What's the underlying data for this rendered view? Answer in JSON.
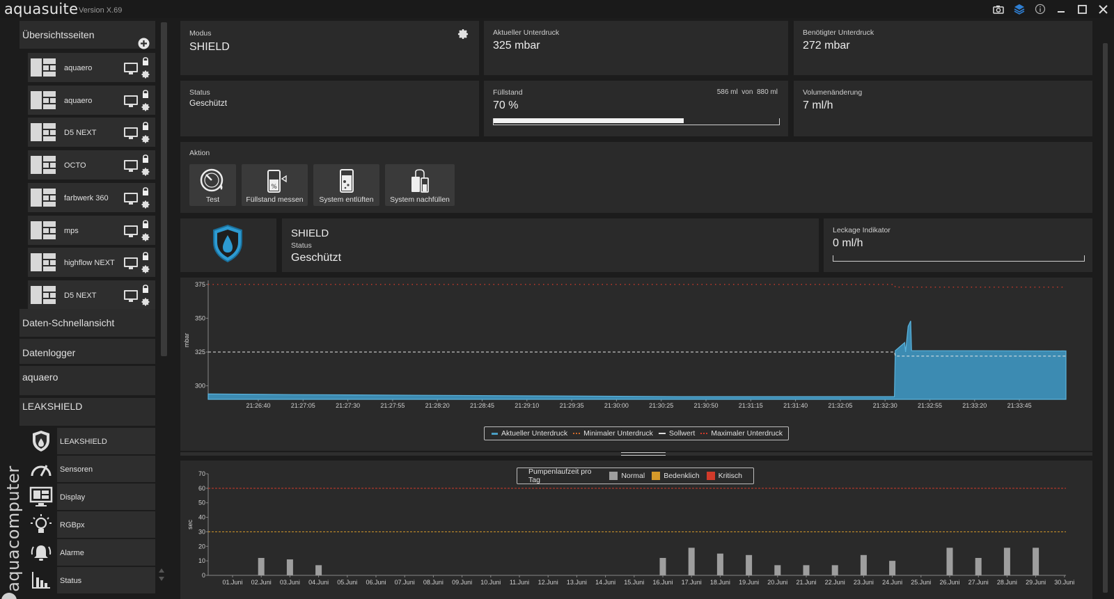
{
  "app": {
    "title": "aquasuite",
    "version": "Version X.69"
  },
  "window_icons": [
    "camera-icon",
    "layers-icon",
    "info-icon",
    "minimize-icon",
    "maximize-icon",
    "close-icon"
  ],
  "sidebar": {
    "overview_header": "Übersichtsseiten",
    "overview_items": [
      "aquaero",
      "aquaero",
      "D5 NEXT",
      "OCTO",
      "farbwerk 360",
      "mps",
      "highflow NEXT",
      "D5 NEXT"
    ],
    "quickview": "Daten-Schnellansicht",
    "datalogger": "Datenlogger",
    "aquaero_section": "aquaero",
    "leakshield_section": "LEAKSHIELD",
    "leakshield_items": [
      {
        "label": "LEAKSHIELD",
        "icon": "shield-icon"
      },
      {
        "label": "Sensoren",
        "icon": "gauge-icon"
      },
      {
        "label": "Display",
        "icon": "display-icon"
      },
      {
        "label": "RGBpx",
        "icon": "bulb-icon"
      },
      {
        "label": "Alarme",
        "icon": "alarm-icon"
      },
      {
        "label": "Status",
        "icon": "bar-chart-icon"
      }
    ],
    "brand_vertical": "aquacomputer"
  },
  "modus": {
    "label": "Modus",
    "value": "SHIELD"
  },
  "current_pressure": {
    "label": "Aktueller Unterdruck",
    "value": "325 mbar"
  },
  "required_pressure": {
    "label": "Benötigter Unterdruck",
    "value": "272 mbar"
  },
  "status": {
    "label": "Status",
    "value": "Geschützt"
  },
  "fill": {
    "label": "Füllstand",
    "value": "70 %",
    "amount": "586 ml",
    "of_word": "von",
    "capacity": "880 ml",
    "fraction": 0.666
  },
  "volume_change": {
    "label": "Volumenänderung",
    "value": "7 ml/h"
  },
  "actions": {
    "label": "Aktion",
    "buttons": [
      "Test",
      "Füllstand messen",
      "System entlüften",
      "System nachfüllen"
    ]
  },
  "shield_panel": {
    "title": "SHIELD",
    "status_label": "Status",
    "status_value": "Geschützt"
  },
  "leak": {
    "label": "Leckage Indikator",
    "value": "0 ml/h",
    "fraction": 0
  },
  "colors": {
    "accent": "#4a9fc4",
    "area_fill": "#3c8bb2",
    "critical": "#d13a2a",
    "warning": "#d69a2a",
    "normal": "#9e9e9e"
  },
  "chart_data": [
    {
      "type": "area",
      "ylabel": "mbar",
      "ylim": [
        290,
        378
      ],
      "yticks": [
        300,
        325,
        350,
        375
      ],
      "x_ticks": [
        "21:26:40",
        "21:27:05",
        "21:27:30",
        "21:27:55",
        "21:28:20",
        "21:28:45",
        "21:29:10",
        "21:29:35",
        "21:30:00",
        "21:30:25",
        "21:30:50",
        "21:31:15",
        "21:31:40",
        "21:32:05",
        "21:32:30",
        "21:32:55",
        "21:33:20",
        "21:33:45"
      ],
      "series": [
        {
          "name": "Aktueller Unterdruck",
          "points": [
            [
              0,
              294
            ],
            [
              10,
              293.5
            ],
            [
              25,
              293
            ],
            [
              40,
              292.5
            ],
            [
              55,
              292
            ],
            [
              70,
              292
            ],
            [
              80,
              292
            ],
            [
              80.1,
              326
            ],
            [
              81.2,
              332
            ],
            [
              81.3,
              325
            ],
            [
              81.6,
              344
            ],
            [
              81.9,
              348
            ],
            [
              82,
              326
            ],
            [
              90,
              326
            ],
            [
              100,
              325.8
            ]
          ]
        },
        {
          "name": "Minimaler Unterdruck",
          "style": "dotted"
        },
        {
          "name": "Sollwert",
          "points": [
            [
              0,
              325
            ],
            [
              80,
              325
            ],
            [
              80.1,
              322
            ],
            [
              100,
              322
            ]
          ],
          "style": "dashed"
        },
        {
          "name": "Maximaler Unterdruck",
          "points": [
            [
              0,
              375
            ],
            [
              80,
              375
            ],
            [
              80.1,
              373
            ],
            [
              100,
              373
            ]
          ],
          "style": "dotted"
        }
      ]
    },
    {
      "type": "bar",
      "title": "Pumpenlaufzeit pro Tag",
      "ylabel": "sec",
      "ylim": [
        0,
        70
      ],
      "yticks": [
        0,
        10,
        20,
        30,
        40,
        50,
        60,
        70
      ],
      "categories": [
        "01.Juni",
        "02.Juni",
        "03.Juni",
        "04.Juni",
        "05.Juni",
        "06.Juni",
        "07.Juni",
        "08.Juni",
        "09.Juni",
        "10.Juni",
        "11.Juni",
        "12.Juni",
        "13.Juni",
        "14.Juni",
        "15.Juni",
        "16.Juni",
        "17.Juni",
        "18.Juni",
        "19.Juni",
        "20.Juni",
        "21.Juni",
        "22.Juni",
        "23.Juni",
        "24.Juni",
        "25.Juni",
        "26.Juni",
        "27.Juni",
        "28.Juni",
        "29.Juni",
        "30.Juni"
      ],
      "values": [
        0,
        12,
        11,
        7,
        0,
        0,
        0,
        0,
        0,
        0,
        0,
        0,
        0,
        0,
        0,
        12,
        19,
        15,
        14,
        7,
        7,
        7,
        14,
        10,
        0,
        19,
        12,
        19,
        19,
        0
      ],
      "legend": [
        "Normal",
        "Bedenklich",
        "Kritisch"
      ],
      "thresholds": {
        "warning": 30,
        "critical": 60
      }
    }
  ]
}
